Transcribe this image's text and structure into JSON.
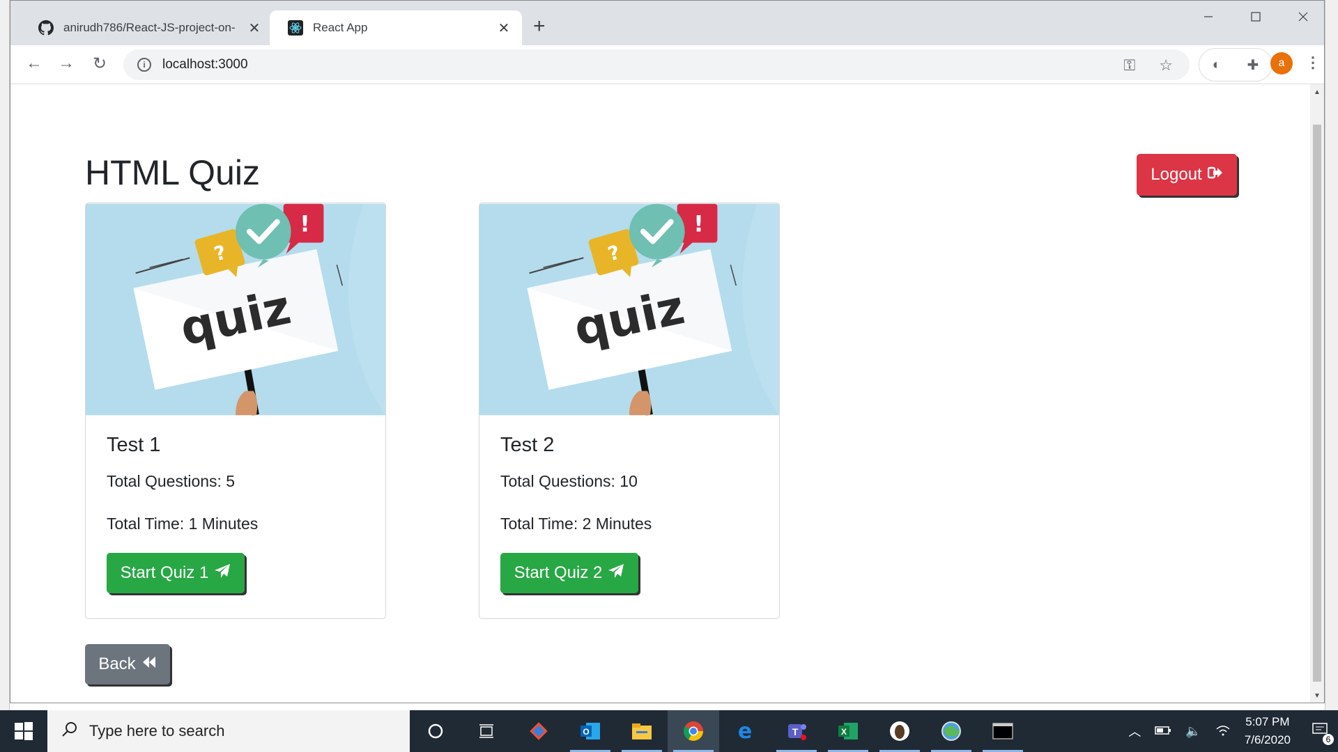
{
  "browser": {
    "tabs": [
      {
        "title": "anirudh786/React-JS-project-on-",
        "icon": "github-icon",
        "active": false
      },
      {
        "title": "React App",
        "icon": "react-icon",
        "active": true
      }
    ],
    "address": "localhost:3000"
  },
  "page": {
    "title": "HTML Quiz",
    "logout_label": "Logout",
    "back_label": "Back",
    "image_text": "quiz",
    "cards": [
      {
        "title": "Test 1",
        "questions": "Total Questions: 5",
        "time": "Total Time: 1 Minutes",
        "button": "Start Quiz 1"
      },
      {
        "title": "Test 2",
        "questions": "Total Questions: 10",
        "time": "Total Time: 2 Minutes",
        "button": "Start Quiz 2"
      }
    ],
    "colors": {
      "logout": "#dc3545",
      "start": "#28a745",
      "back": "#6c757d"
    }
  },
  "taskbar": {
    "search_placeholder": "Type here to search",
    "time": "5:07 PM",
    "date": "7/6/2020",
    "notifications": "6"
  }
}
